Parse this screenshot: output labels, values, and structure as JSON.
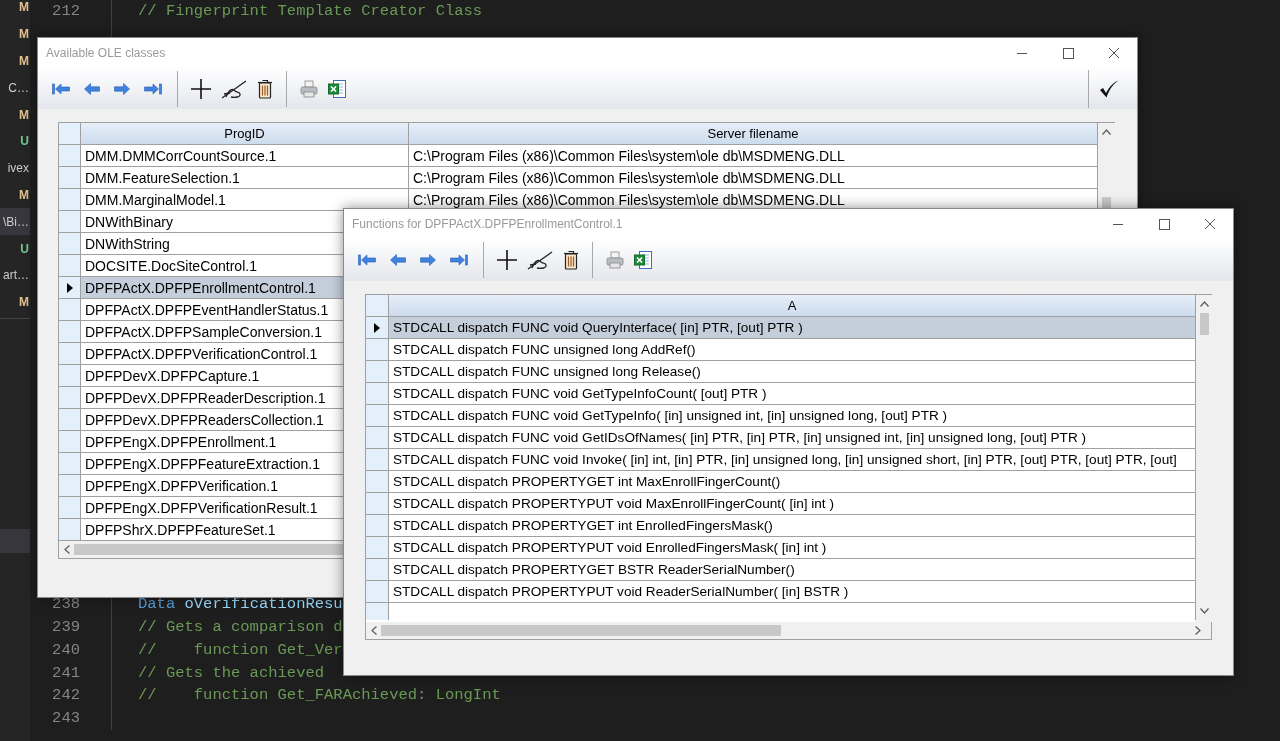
{
  "explorer": {
    "items": [
      {
        "text": "M",
        "kind": "modified"
      },
      {
        "text": "M",
        "kind": "modified"
      },
      {
        "text": "M",
        "kind": "modified"
      },
      {
        "text": "C…",
        "kind": "name"
      },
      {
        "text": "M",
        "kind": "modified"
      },
      {
        "text": "U",
        "kind": "untracked"
      },
      {
        "text": "ivex",
        "kind": "name"
      },
      {
        "text": "M",
        "kind": "modified"
      },
      {
        "text": "\\Bi…",
        "kind": "name"
      },
      {
        "text": "U",
        "kind": "untracked"
      },
      {
        "text": "art…",
        "kind": "name"
      },
      {
        "text": "M",
        "kind": "modified"
      }
    ]
  },
  "editor": {
    "top_lines": [
      {
        "number": "212",
        "tokens": [
          {
            "text": "// Fingerprint Template Creator Class",
            "kind": "comment"
          }
        ]
      }
    ],
    "bottom_lines": [
      {
        "number": "238",
        "tokens": [
          {
            "text": "Data",
            "kind": "keyword"
          },
          {
            "text": "oVerificationResu",
            "kind": "variable"
          }
        ]
      },
      {
        "number": "239",
        "tokens": [
          {
            "text": "// Gets a comparison d",
            "kind": "comment"
          }
        ]
      },
      {
        "number": "240",
        "tokens": [
          {
            "text": "//    function Get_Ver",
            "kind": "comment"
          }
        ]
      },
      {
        "number": "241",
        "tokens": [
          {
            "text": "// Gets the achieved",
            "kind": "comment"
          }
        ]
      },
      {
        "number": "242",
        "tokens": [
          {
            "text": "//    function Get_FARAchieved: LongInt",
            "kind": "comment"
          }
        ]
      },
      {
        "number": "243"
      }
    ]
  },
  "windows": [
    {
      "title": "Available OLE classes",
      "columns": [
        "ProgID",
        "Server filename"
      ],
      "rows": [
        {
          "cells": [
            "DMM.DMMCorrCountSource.1",
            "C:\\Program Files (x86)\\Common Files\\system\\ole db\\MSDMENG.DLL"
          ],
          "selected": false
        },
        {
          "cells": [
            "DMM.FeatureSelection.1",
            "C:\\Program Files (x86)\\Common Files\\system\\ole db\\MSDMENG.DLL"
          ],
          "selected": false
        },
        {
          "cells": [
            "DMM.MarginalModel.1",
            "C:\\Program Files (x86)\\Common Files\\system\\ole db\\MSDMENG.DLL"
          ],
          "selected": false
        },
        {
          "cells": [
            "DNWithBinary"
          ],
          "selected": false
        },
        {
          "cells": [
            "DNWithString"
          ],
          "selected": false
        },
        {
          "cells": [
            "DOCSITE.DocSiteControl.1"
          ],
          "selected": false
        },
        {
          "cells": [
            "DPFPActX.DPFPEnrollmentControl.1"
          ],
          "selected": true
        },
        {
          "cells": [
            "DPFPActX.DPFPEventHandlerStatus.1"
          ],
          "selected": false
        },
        {
          "cells": [
            "DPFPActX.DPFPSampleConversion.1"
          ],
          "selected": false
        },
        {
          "cells": [
            "DPFPActX.DPFPVerificationControl.1"
          ],
          "selected": false
        },
        {
          "cells": [
            "DPFPDevX.DPFPCapture.1"
          ],
          "selected": false
        },
        {
          "cells": [
            "DPFPDevX.DPFPReaderDescription.1"
          ],
          "selected": false
        },
        {
          "cells": [
            "DPFPDevX.DPFPReadersCollection.1"
          ],
          "selected": false
        },
        {
          "cells": [
            "DPFPEngX.DPFPEnrollment.1"
          ],
          "selected": false
        },
        {
          "cells": [
            "DPFPEngX.DPFPFeatureExtraction.1"
          ],
          "selected": false
        },
        {
          "cells": [
            "DPFPEngX.DPFPVerification.1"
          ],
          "selected": false
        },
        {
          "cells": [
            "DPFPEngX.DPFPVerificationResult.1"
          ],
          "selected": false
        },
        {
          "cells": [
            "DPFPShrX.DPFPFeatureSet.1"
          ],
          "selected": false
        }
      ]
    },
    {
      "title": "Functions for DPFPActX.DPFPEnrollmentControl.1",
      "columns": [
        "A"
      ],
      "rows": [
        {
          "cells": [
            "STDCALL dispatch FUNC void QueryInterface( [in] PTR, [out] PTR )"
          ],
          "selected": true
        },
        {
          "cells": [
            "STDCALL dispatch FUNC unsigned long AddRef()"
          ],
          "selected": false
        },
        {
          "cells": [
            "STDCALL dispatch FUNC unsigned long Release()"
          ],
          "selected": false
        },
        {
          "cells": [
            "STDCALL dispatch FUNC void GetTypeInfoCount( [out] PTR )"
          ],
          "selected": false
        },
        {
          "cells": [
            "STDCALL dispatch FUNC void GetTypeInfo( [in] unsigned int, [in] unsigned long, [out] PTR )"
          ],
          "selected": false
        },
        {
          "cells": [
            "STDCALL dispatch FUNC void GetIDsOfNames( [in] PTR, [in] PTR, [in] unsigned int, [in] unsigned long, [out] PTR )"
          ],
          "selected": false
        },
        {
          "cells": [
            "STDCALL dispatch FUNC void Invoke( [in] int, [in] PTR, [in] unsigned long, [in] unsigned short, [in] PTR, [out] PTR, [out] PTR, [out]"
          ],
          "selected": false
        },
        {
          "cells": [
            "STDCALL dispatch PROPERTYGET int MaxEnrollFingerCount()"
          ],
          "selected": false
        },
        {
          "cells": [
            "STDCALL dispatch PROPERTYPUT void MaxEnrollFingerCount( [in] int )"
          ],
          "selected": false
        },
        {
          "cells": [
            "STDCALL dispatch PROPERTYGET int EnrolledFingersMask()"
          ],
          "selected": false
        },
        {
          "cells": [
            "STDCALL dispatch PROPERTYPUT void EnrolledFingersMask( [in] int )"
          ],
          "selected": false
        },
        {
          "cells": [
            "STDCALL dispatch PROPERTYGET BSTR ReaderSerialNumber()"
          ],
          "selected": false
        },
        {
          "cells": [
            "STDCALL dispatch PROPERTYPUT void ReaderSerialNumber( [in] BSTR )"
          ],
          "selected": false
        }
      ]
    }
  ]
}
